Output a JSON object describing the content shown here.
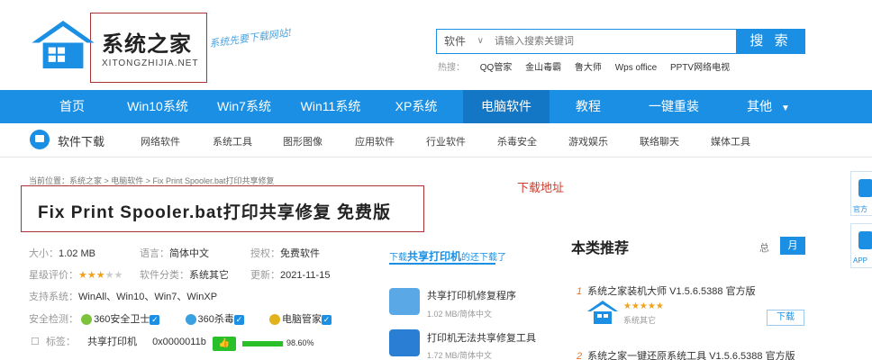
{
  "header": {
    "logo_title": "系统之家",
    "logo_sub": "XITONGZHIJIA.NET",
    "slogan": "系统先要下载网站!",
    "search": {
      "category": "软件",
      "placeholder": "请输入搜索关键词",
      "button": "搜 索"
    },
    "hot_label": "热搜：",
    "hot_items": [
      "QQ管家",
      "金山毒霸",
      "鲁大师",
      "Wps office",
      "PPTV网络电视"
    ]
  },
  "nav": {
    "items": [
      "首页",
      "Win10系统",
      "Win7系统",
      "Win11系统",
      "XP系统",
      "电脑软件",
      "教程",
      "一键重装",
      "其他"
    ],
    "active": "电脑软件"
  },
  "subnav": {
    "title": "软件下载",
    "items": [
      "网络软件",
      "系统工具",
      "图形图像",
      "应用软件",
      "行业软件",
      "杀毒安全",
      "游戏娱乐",
      "联络聊天",
      "媒体工具"
    ]
  },
  "breadcrumb": "当前位置：系统之家 > 电脑软件 > Fix Print Spooler.bat打印共享修复",
  "download_address": "下载地址",
  "page_title": "Fix Print Spooler.bat打印共享修复 免费版",
  "info": {
    "size_label": "大小：",
    "size": "1.02 MB",
    "lang_label": "语言：",
    "lang": "简体中文",
    "license_label": "授权：",
    "license": "免费软件",
    "rating_label": "星级评价：",
    "rating": 3,
    "rating_max": 5,
    "category_label": "软件分类：",
    "category": "系统其它",
    "update_label": "更新：",
    "update": "2021-11-15",
    "os_label": "支持系统：",
    "os": "WinAll、Win10、Win7、WinXP",
    "security_label": "安全检测：",
    "security": [
      "360安全卫士",
      "360杀毒",
      "电脑管家"
    ],
    "tags_label": "标签：",
    "tags": [
      "共享打印机",
      "0x0000011b"
    ],
    "score": "98.60%",
    "score_value": 0.986
  },
  "related": {
    "head_prefix": "下载",
    "head_keyword": "共享打印机",
    "head_suffix": "的还下载了",
    "items": [
      {
        "title": "共享打印机修复程序",
        "meta": "1.02 MB/简体中文"
      },
      {
        "title": "打印机无法共享修复工具",
        "meta": "1.72 MB/简体中文"
      }
    ]
  },
  "recommend": {
    "title": "本类推荐",
    "tab_total": "总",
    "tab_month": "月",
    "items": [
      {
        "num": "1",
        "title": "系统之家装机大师 V1.5.6.5388 官方版",
        "stars": "★★★★★",
        "category": "系统其它",
        "button": "下载"
      },
      {
        "num": "2",
        "title": "系统之家一键还原系统工具 V1.5.6.5388 官方版"
      }
    ]
  },
  "float": {
    "label1": "官方",
    "label2": "APP"
  },
  "colors": {
    "brand": "#1a8fe3",
    "accent": "#d03a2a",
    "star": "#f0a21a",
    "ok": "#2ac02a"
  }
}
